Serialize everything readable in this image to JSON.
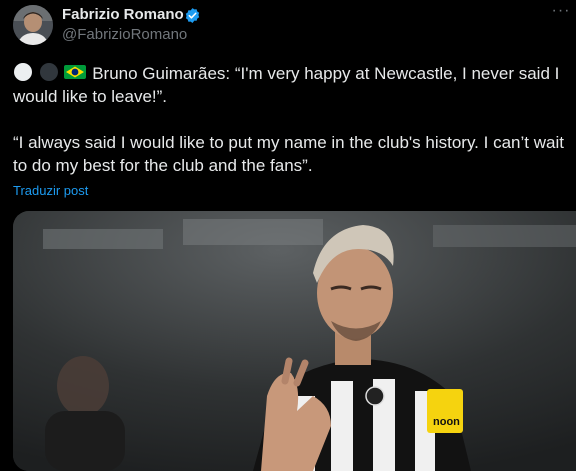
{
  "tweet": {
    "author_name": "Fabrizio Romano",
    "handle": "@FabrizioRomano",
    "text_para1": "Bruno Guimarães: “I'm very happy at Newcastle, I never said I would like to leave!”.",
    "text_para2": "“I always said I would like to put my name in the club's history. I can’t wait to do my best for the club and the fans”.",
    "emojis": [
      "white-circle-icon",
      "black-circle-icon",
      "brazil-flag-icon"
    ],
    "translate_label": "Traduzir post",
    "more_label": "···",
    "armband_text": "noon"
  },
  "colors": {
    "background": "#000000",
    "text": "#e7e9ea",
    "secondary": "#71767b",
    "link": "#1d9bf0",
    "verified": "#1d9bf0"
  }
}
